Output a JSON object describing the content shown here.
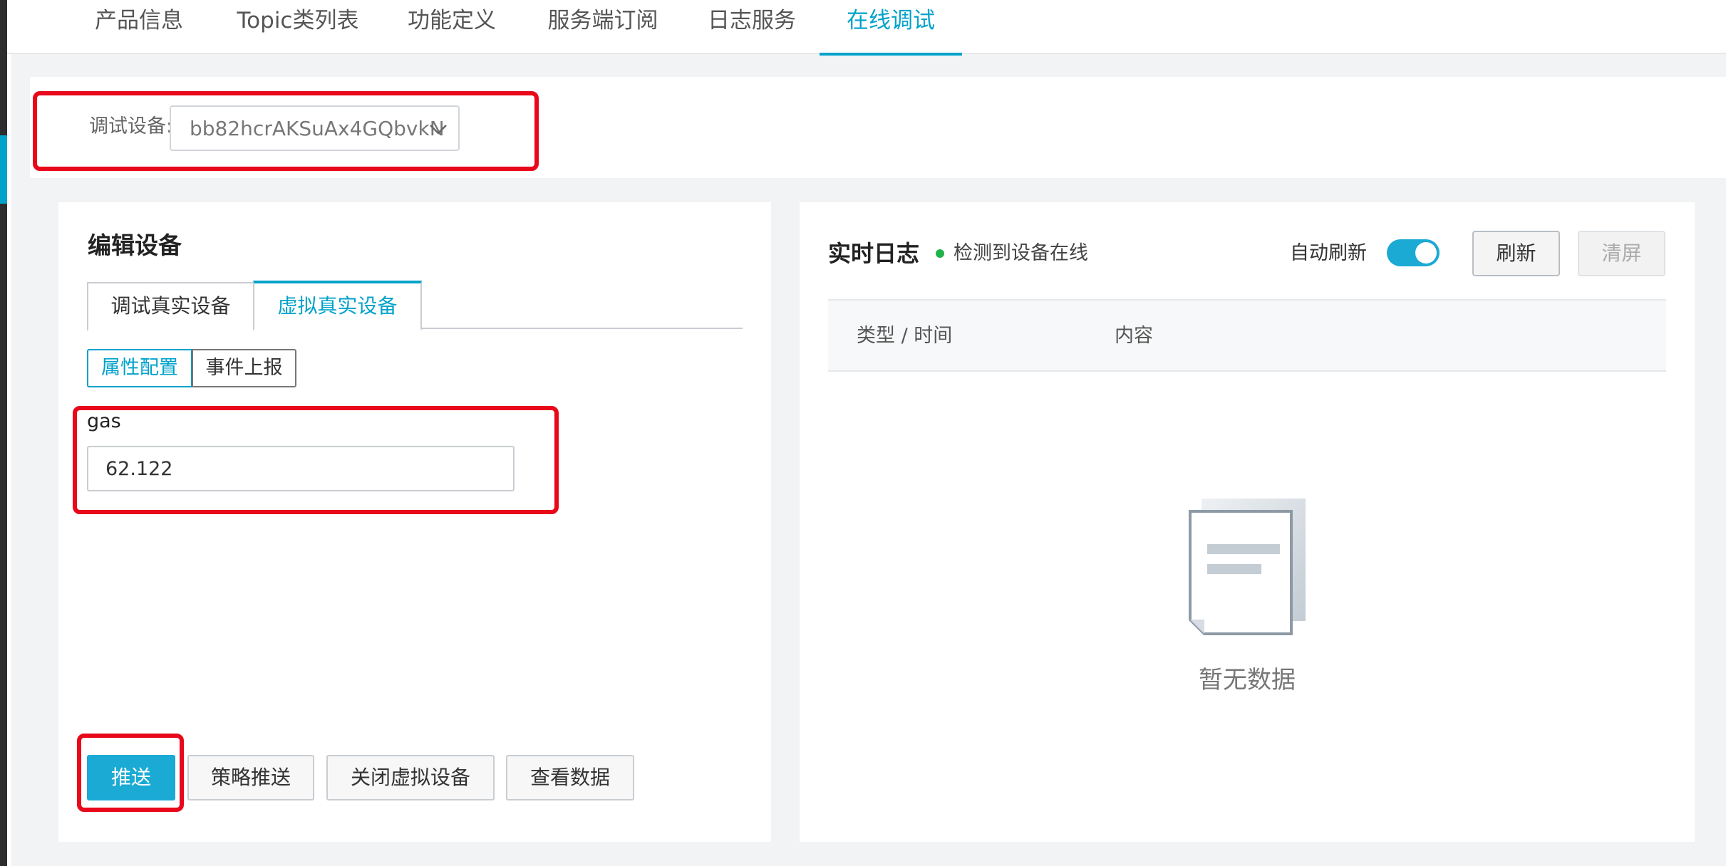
{
  "top_tabs": [
    {
      "label": "产品信息"
    },
    {
      "label": "Topic类列表"
    },
    {
      "label": "功能定义"
    },
    {
      "label": "服务端订阅"
    },
    {
      "label": "日志服务"
    },
    {
      "label": "在线调试",
      "active": true
    }
  ],
  "device": {
    "label": "调试设备:",
    "selected": "bb82hcrAKSuAx4GQbvkN"
  },
  "edit": {
    "title": "编辑设备",
    "tabs": [
      {
        "label": "调试真实设备"
      },
      {
        "label": "虚拟真实设备",
        "active": true
      }
    ],
    "subtabs": [
      {
        "label": "属性配置",
        "active": true
      },
      {
        "label": "事件上报"
      }
    ],
    "property": {
      "name": "gas",
      "value": "62.122"
    },
    "buttons": {
      "push": "推送",
      "policy_push": "策略推送",
      "close_virtual": "关闭虚拟设备",
      "view_data": "查看数据"
    }
  },
  "log": {
    "title": "实时日志",
    "status": "检测到设备在线",
    "auto_refresh_label": "自动刷新",
    "auto_refresh_on": true,
    "refresh": "刷新",
    "clear": "清屏",
    "columns": [
      "类型 / 时间",
      "内容"
    ],
    "empty": "暂无数据"
  },
  "colors": {
    "accent": "#00a2ca",
    "primary_button": "#1aaad4",
    "online": "#1fb34b",
    "highlight": "#e8081a"
  }
}
